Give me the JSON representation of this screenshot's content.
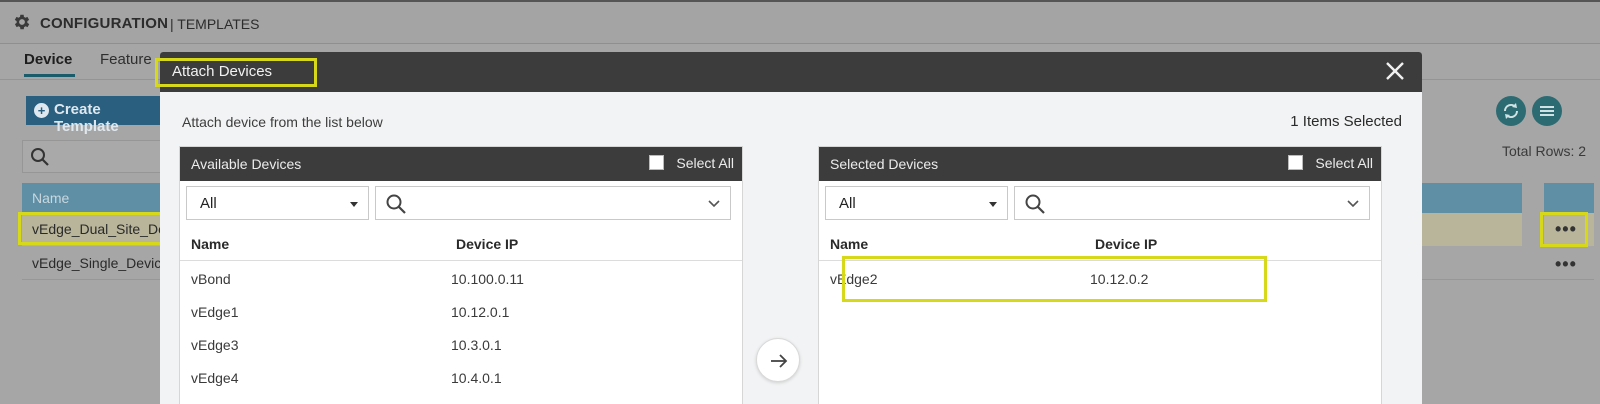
{
  "header": {
    "title": "CONFIGURATION",
    "subtitle": "| TEMPLATES",
    "icon": "gear-icon"
  },
  "tabs": [
    {
      "label": "Device",
      "active": true
    },
    {
      "label": "Feature",
      "active": false
    }
  ],
  "toolbar": {
    "create_label": "Create Template",
    "total_rows": "Total Rows: 2"
  },
  "templates_table": {
    "columns": [
      "Name"
    ],
    "rows": [
      {
        "name": "vEdge_Dual_Site_Device"
      },
      {
        "name": "vEdge_Single_Device"
      }
    ]
  },
  "modal": {
    "title": "Attach Devices",
    "instruction": "Attach device from the list below",
    "items_selected": "1 Items Selected",
    "available": {
      "title": "Available Devices",
      "select_all_label": "Select All",
      "filter_value": "All",
      "columns": [
        "Name",
        "Device IP"
      ],
      "rows": [
        {
          "name": "vBond",
          "ip": "10.100.0.11"
        },
        {
          "name": "vEdge1",
          "ip": "10.12.0.1"
        },
        {
          "name": "vEdge3",
          "ip": "10.3.0.1"
        },
        {
          "name": "vEdge4",
          "ip": "10.4.0.1"
        }
      ]
    },
    "selected": {
      "title": "Selected Devices",
      "select_all_label": "Select All",
      "filter_value": "All",
      "columns": [
        "Name",
        "Device IP"
      ],
      "rows": [
        {
          "name": "vEdge2",
          "ip": "10.12.0.2"
        }
      ]
    }
  },
  "colors": {
    "modal_header": "#3c3c3c",
    "highlight": "#d8d81a",
    "primary_button": "#2a5f80",
    "table_header": "#5e8fa5"
  }
}
